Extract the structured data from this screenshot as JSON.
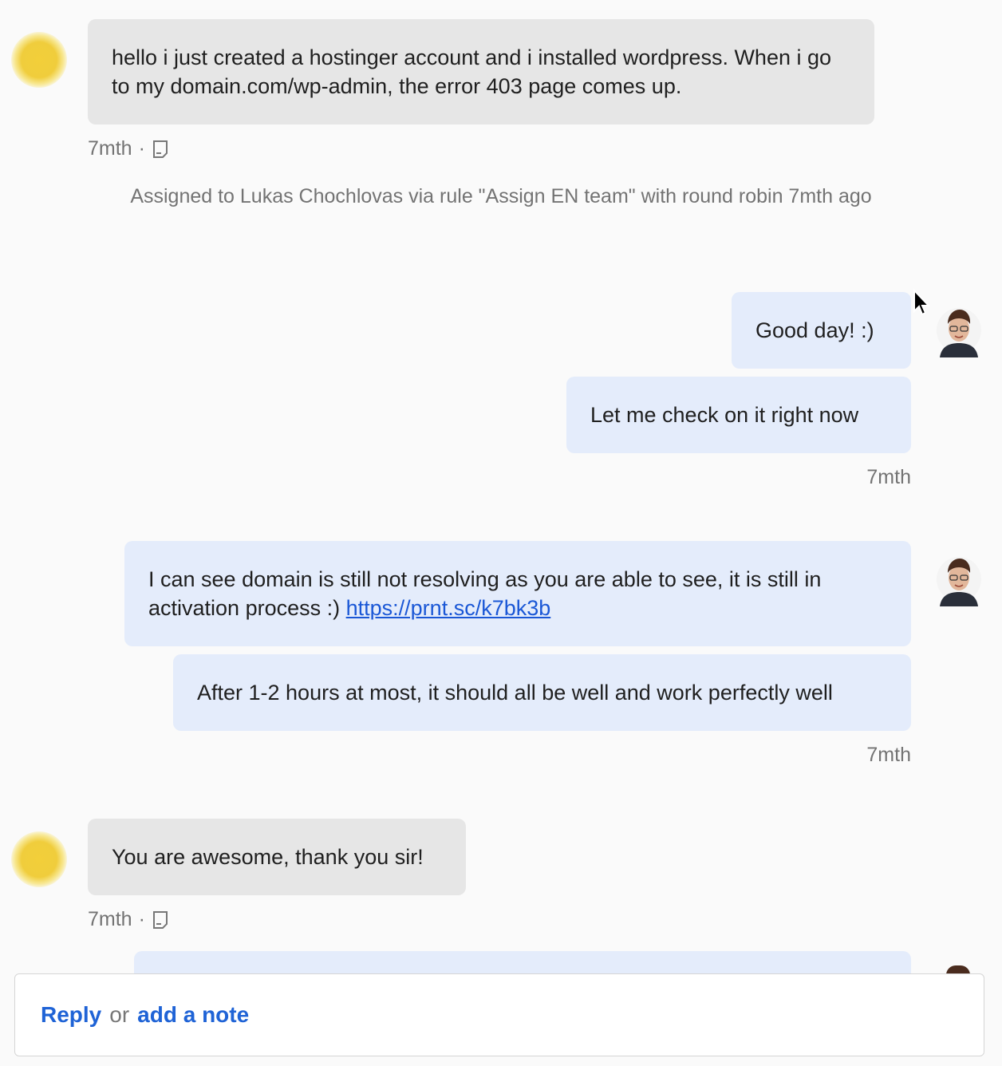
{
  "messages": [
    {
      "text": "hello i just created a hostinger account and i installed wordpress. When i go to my domain.com/wp-admin, the error 403 page comes up.",
      "time": "7mth",
      "sep": "·"
    },
    {
      "text": "Good day! :)"
    },
    {
      "text": "Let me check on it right now",
      "time": "7mth"
    },
    {
      "text_before": "I can see domain is still not resolving as you are able to see, it is still in activation process :)",
      "link": "https://prnt.sc/k7bk3b"
    },
    {
      "text": "After 1-2 hours at most, it should all be well and work perfectly well",
      "time": "7mth"
    },
    {
      "text": "You are awesome, thank you sir!",
      "time": "7mth",
      "sep": "·"
    }
  ],
  "assignment": "Assigned to Lukas Chochlovas via rule \"Assign EN team\" with round robin 7mth ago",
  "composer": {
    "reply": "Reply",
    "or": "or",
    "note": "add a note"
  },
  "icons": {
    "note": "note-icon",
    "avatar_user": "user-avatar",
    "avatar_agent": "agent-avatar",
    "cursor": "mouse-cursor-icon"
  }
}
